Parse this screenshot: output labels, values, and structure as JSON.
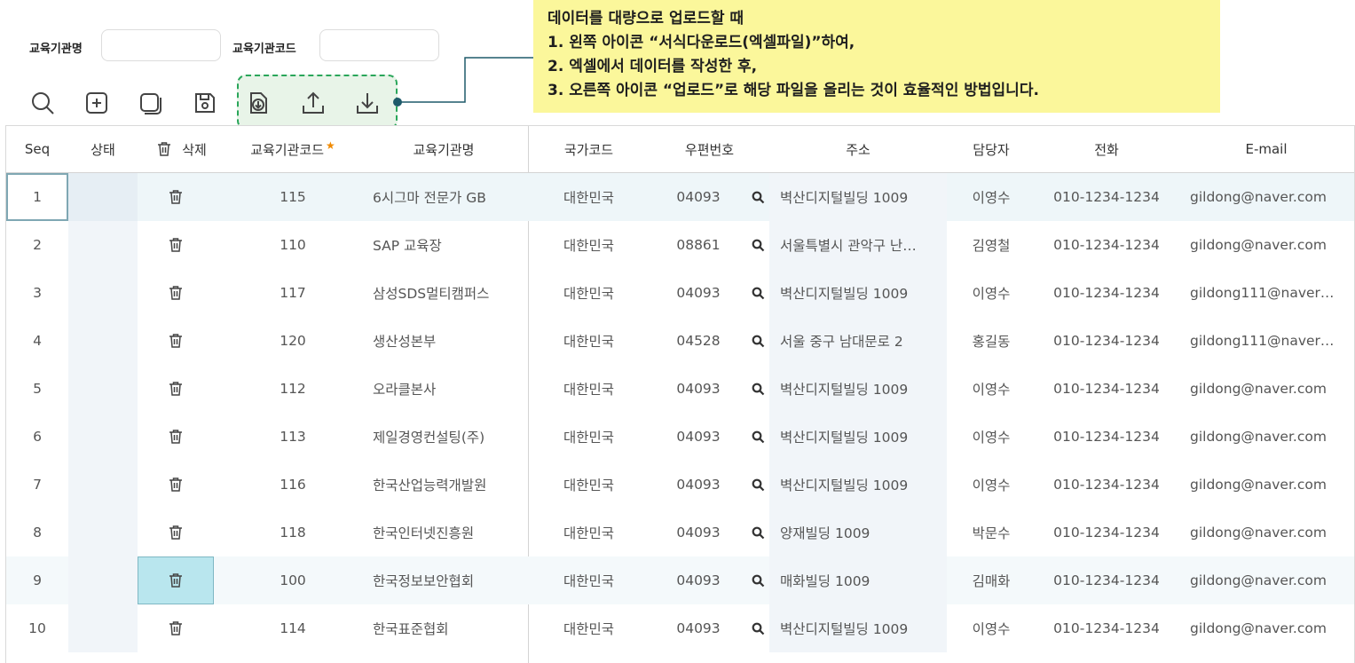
{
  "filters": {
    "name_label": "교육기관명",
    "name_value": "",
    "code_label": "교육기관코드",
    "code_value": ""
  },
  "toolbar": {
    "icons": [
      "search-icon",
      "add-icon",
      "copy-icon",
      "save-icon",
      "template-download-icon",
      "upload-icon",
      "download-icon"
    ]
  },
  "note": {
    "line1": "데이터를 대량으로 업로드할 때",
    "line2": "1.  왼쪽 아이콘 “서식다운로드(엑셀파일)”하여,",
    "line3": "2.  엑셀에서 데이터를 작성한 후,",
    "line4": "3.  오른쪽 아이콘 “업로드”로 해당 파일을 올리는 것이 효율적인 방법입니다."
  },
  "columns": {
    "seq": "Seq",
    "status": "상태",
    "delete": "삭제",
    "code": "교육기관코드",
    "name": "교육기관명",
    "country": "국가코드",
    "zip": "우편번호",
    "address": "주소",
    "manager": "담당자",
    "phone": "전화",
    "email": "E-mail"
  },
  "colors": {
    "accent_green": "#2aa65a",
    "note_bg": "#fbf79b",
    "selected_row": "#eef6f9",
    "selected_cell": "#b9e6ee",
    "required_star": "#f08a00"
  },
  "rows": [
    {
      "seq": "1",
      "code": "115",
      "name": "6시그마 전문가 GB",
      "country": "대한민국",
      "zip": "04093",
      "address": "벽산디지털빌딩 1009",
      "manager": "이영수",
      "phone": "010-1234-1234",
      "email": "gildong@naver.com"
    },
    {
      "seq": "2",
      "code": "110",
      "name": "SAP 교육장",
      "country": "대한민국",
      "zip": "08861",
      "address": "서울특별시 관악구 난…",
      "manager": "김영철",
      "phone": "010-1234-1234",
      "email": "gildong@naver.com"
    },
    {
      "seq": "3",
      "code": "117",
      "name": "삼성SDS멀티캠퍼스",
      "country": "대한민국",
      "zip": "04093",
      "address": "벽산디지털빌딩 1009",
      "manager": "이영수",
      "phone": "010-1234-1234",
      "email": "gildong111@naver…"
    },
    {
      "seq": "4",
      "code": "120",
      "name": "생산성본부",
      "country": "대한민국",
      "zip": "04528",
      "address": "서울 중구 남대문로 2",
      "manager": "홍길동",
      "phone": "010-1234-1234",
      "email": "gildong111@naver…"
    },
    {
      "seq": "5",
      "code": "112",
      "name": "오라클본사",
      "country": "대한민국",
      "zip": "04093",
      "address": "벽산디지털빌딩 1009",
      "manager": "이영수",
      "phone": "010-1234-1234",
      "email": "gildong@naver.com"
    },
    {
      "seq": "6",
      "code": "113",
      "name": "제일경영컨설팅(주)",
      "country": "대한민국",
      "zip": "04093",
      "address": "벽산디지털빌딩 1009",
      "manager": "이영수",
      "phone": "010-1234-1234",
      "email": "gildong@naver.com"
    },
    {
      "seq": "7",
      "code": "116",
      "name": "한국산업능력개발원",
      "country": "대한민국",
      "zip": "04093",
      "address": "벽산디지털빌딩 1009",
      "manager": "이영수",
      "phone": "010-1234-1234",
      "email": "gildong@naver.com"
    },
    {
      "seq": "8",
      "code": "118",
      "name": "한국인터넷진흥원",
      "country": "대한민국",
      "zip": "04093",
      "address": "양재빌딩 1009",
      "manager": "박문수",
      "phone": "010-1234-1234",
      "email": "gildong@naver.com"
    },
    {
      "seq": "9",
      "code": "100",
      "name": "한국정보보안협회",
      "country": "대한민국",
      "zip": "04093",
      "address": "매화빌딩 1009",
      "manager": "김매화",
      "phone": "010-1234-1234",
      "email": "gildong@naver.com"
    },
    {
      "seq": "10",
      "code": "114",
      "name": "한국표준협회",
      "country": "대한민국",
      "zip": "04093",
      "address": "벽산디지털빌딩 1009",
      "manager": "이영수",
      "phone": "010-1234-1234",
      "email": "gildong@naver.com"
    }
  ]
}
